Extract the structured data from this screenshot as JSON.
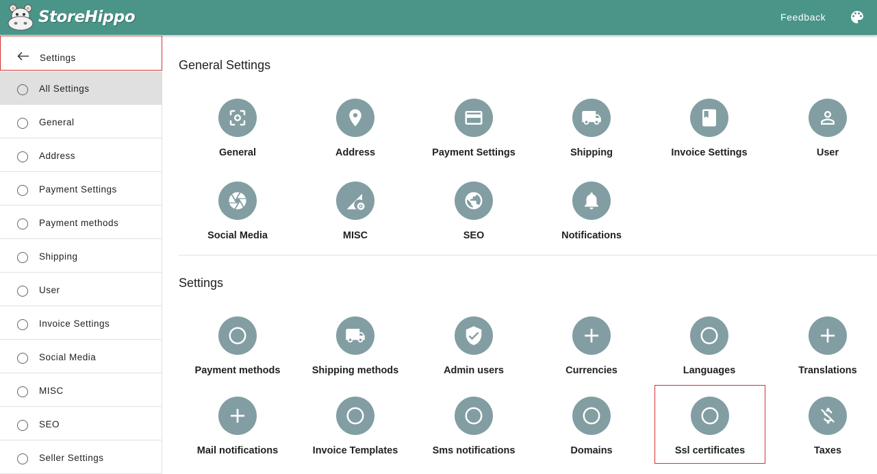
{
  "app": {
    "name": "StoreHippo",
    "feedback_label": "Feedback",
    "colors": {
      "topbar": "#4a9488",
      "icon_bg": "#829ea3",
      "highlight": "#d32f2f",
      "active_item": "#e0e0e0"
    }
  },
  "sidebar": {
    "header_label": "Settings",
    "items": [
      {
        "label": "All Settings"
      },
      {
        "label": "General"
      },
      {
        "label": "Address"
      },
      {
        "label": "Payment Settings"
      },
      {
        "label": "Payment methods"
      },
      {
        "label": "Shipping"
      },
      {
        "label": "User"
      },
      {
        "label": "Invoice Settings"
      },
      {
        "label": "Social Media"
      },
      {
        "label": "MISC"
      },
      {
        "label": "SEO"
      },
      {
        "label": "Seller Settings"
      }
    ]
  },
  "general_settings": {
    "title": "General Settings",
    "tiles": [
      {
        "label": "General",
        "icon": "center-focus-icon"
      },
      {
        "label": "Address",
        "icon": "location-pin-icon"
      },
      {
        "label": "Payment Settings",
        "icon": "credit-card-icon"
      },
      {
        "label": "Shipping",
        "icon": "truck-icon"
      },
      {
        "label": "Invoice Settings",
        "icon": "book-icon"
      },
      {
        "label": "User",
        "icon": "person-icon"
      },
      {
        "label": "Social Media",
        "icon": "camera-shutter-icon"
      },
      {
        "label": "MISC",
        "icon": "network-gear-icon"
      },
      {
        "label": "SEO",
        "icon": "globe-icon"
      },
      {
        "label": "Notifications",
        "icon": "bell-icon"
      }
    ]
  },
  "settings": {
    "title": "Settings",
    "tiles": [
      {
        "label": "Payment methods",
        "icon": "circle-outline-icon"
      },
      {
        "label": "Shipping methods",
        "icon": "truck-icon"
      },
      {
        "label": "Admin users",
        "icon": "verified-shield-icon"
      },
      {
        "label": "Currencies",
        "icon": "plus-icon"
      },
      {
        "label": "Languages",
        "icon": "circle-outline-icon"
      },
      {
        "label": "Translations",
        "icon": "plus-icon"
      },
      {
        "label": "Mail notifications",
        "icon": "plus-icon"
      },
      {
        "label": "Invoice Templates",
        "icon": "circle-outline-icon"
      },
      {
        "label": "Sms notifications",
        "icon": "circle-outline-icon"
      },
      {
        "label": "Domains",
        "icon": "circle-outline-icon"
      },
      {
        "label": "Ssl certificates",
        "icon": "circle-outline-icon"
      },
      {
        "label": "Taxes",
        "icon": "money-off-icon"
      }
    ]
  }
}
